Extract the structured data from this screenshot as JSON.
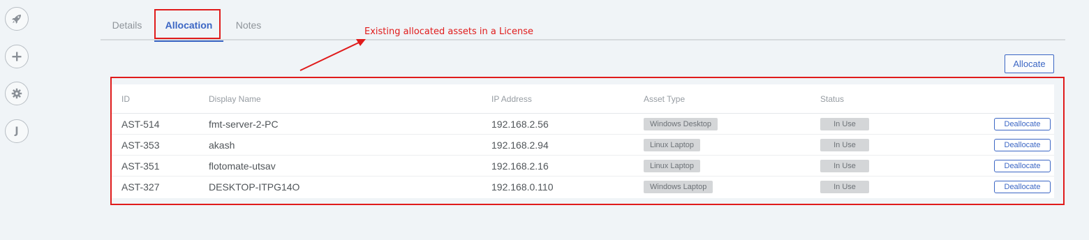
{
  "rail": {
    "items": [
      {
        "icon": "rocket-icon"
      },
      {
        "icon": "plus-icon"
      },
      {
        "icon": "gear-icon"
      },
      {
        "icon": "j-icon",
        "letter": "J"
      }
    ]
  },
  "tabs": [
    {
      "label": "Details",
      "active": false
    },
    {
      "label": "Allocation",
      "active": true
    },
    {
      "label": "Notes",
      "active": false
    }
  ],
  "annotation": {
    "text": "Existing allocated assets in a License",
    "color": "#e01b1b"
  },
  "allocate_button": "Allocate",
  "table": {
    "columns": [
      "ID",
      "Display Name",
      "IP Address",
      "Asset Type",
      "Status"
    ],
    "rows": [
      {
        "id": "AST-514",
        "name": "fmt-server-2-PC",
        "ip": "192.168.2.56",
        "asset_type": "Windows Desktop",
        "status": "In Use",
        "action": "Deallocate"
      },
      {
        "id": "AST-353",
        "name": "akash",
        "ip": "192.168.2.94",
        "asset_type": "Linux Laptop",
        "status": "In Use",
        "action": "Deallocate"
      },
      {
        "id": "AST-351",
        "name": "flotomate-utsav",
        "ip": "192.168.2.16",
        "asset_type": "Linux Laptop",
        "status": "In Use",
        "action": "Deallocate"
      },
      {
        "id": "AST-327",
        "name": "DESKTOP-ITPG14O",
        "ip": "192.168.0.110",
        "asset_type": "Windows Laptop",
        "status": "In Use",
        "action": "Deallocate"
      }
    ]
  },
  "colors": {
    "accent": "#3b66c4",
    "annotation_red": "#e01b1b",
    "background": "#f0f4f7"
  }
}
